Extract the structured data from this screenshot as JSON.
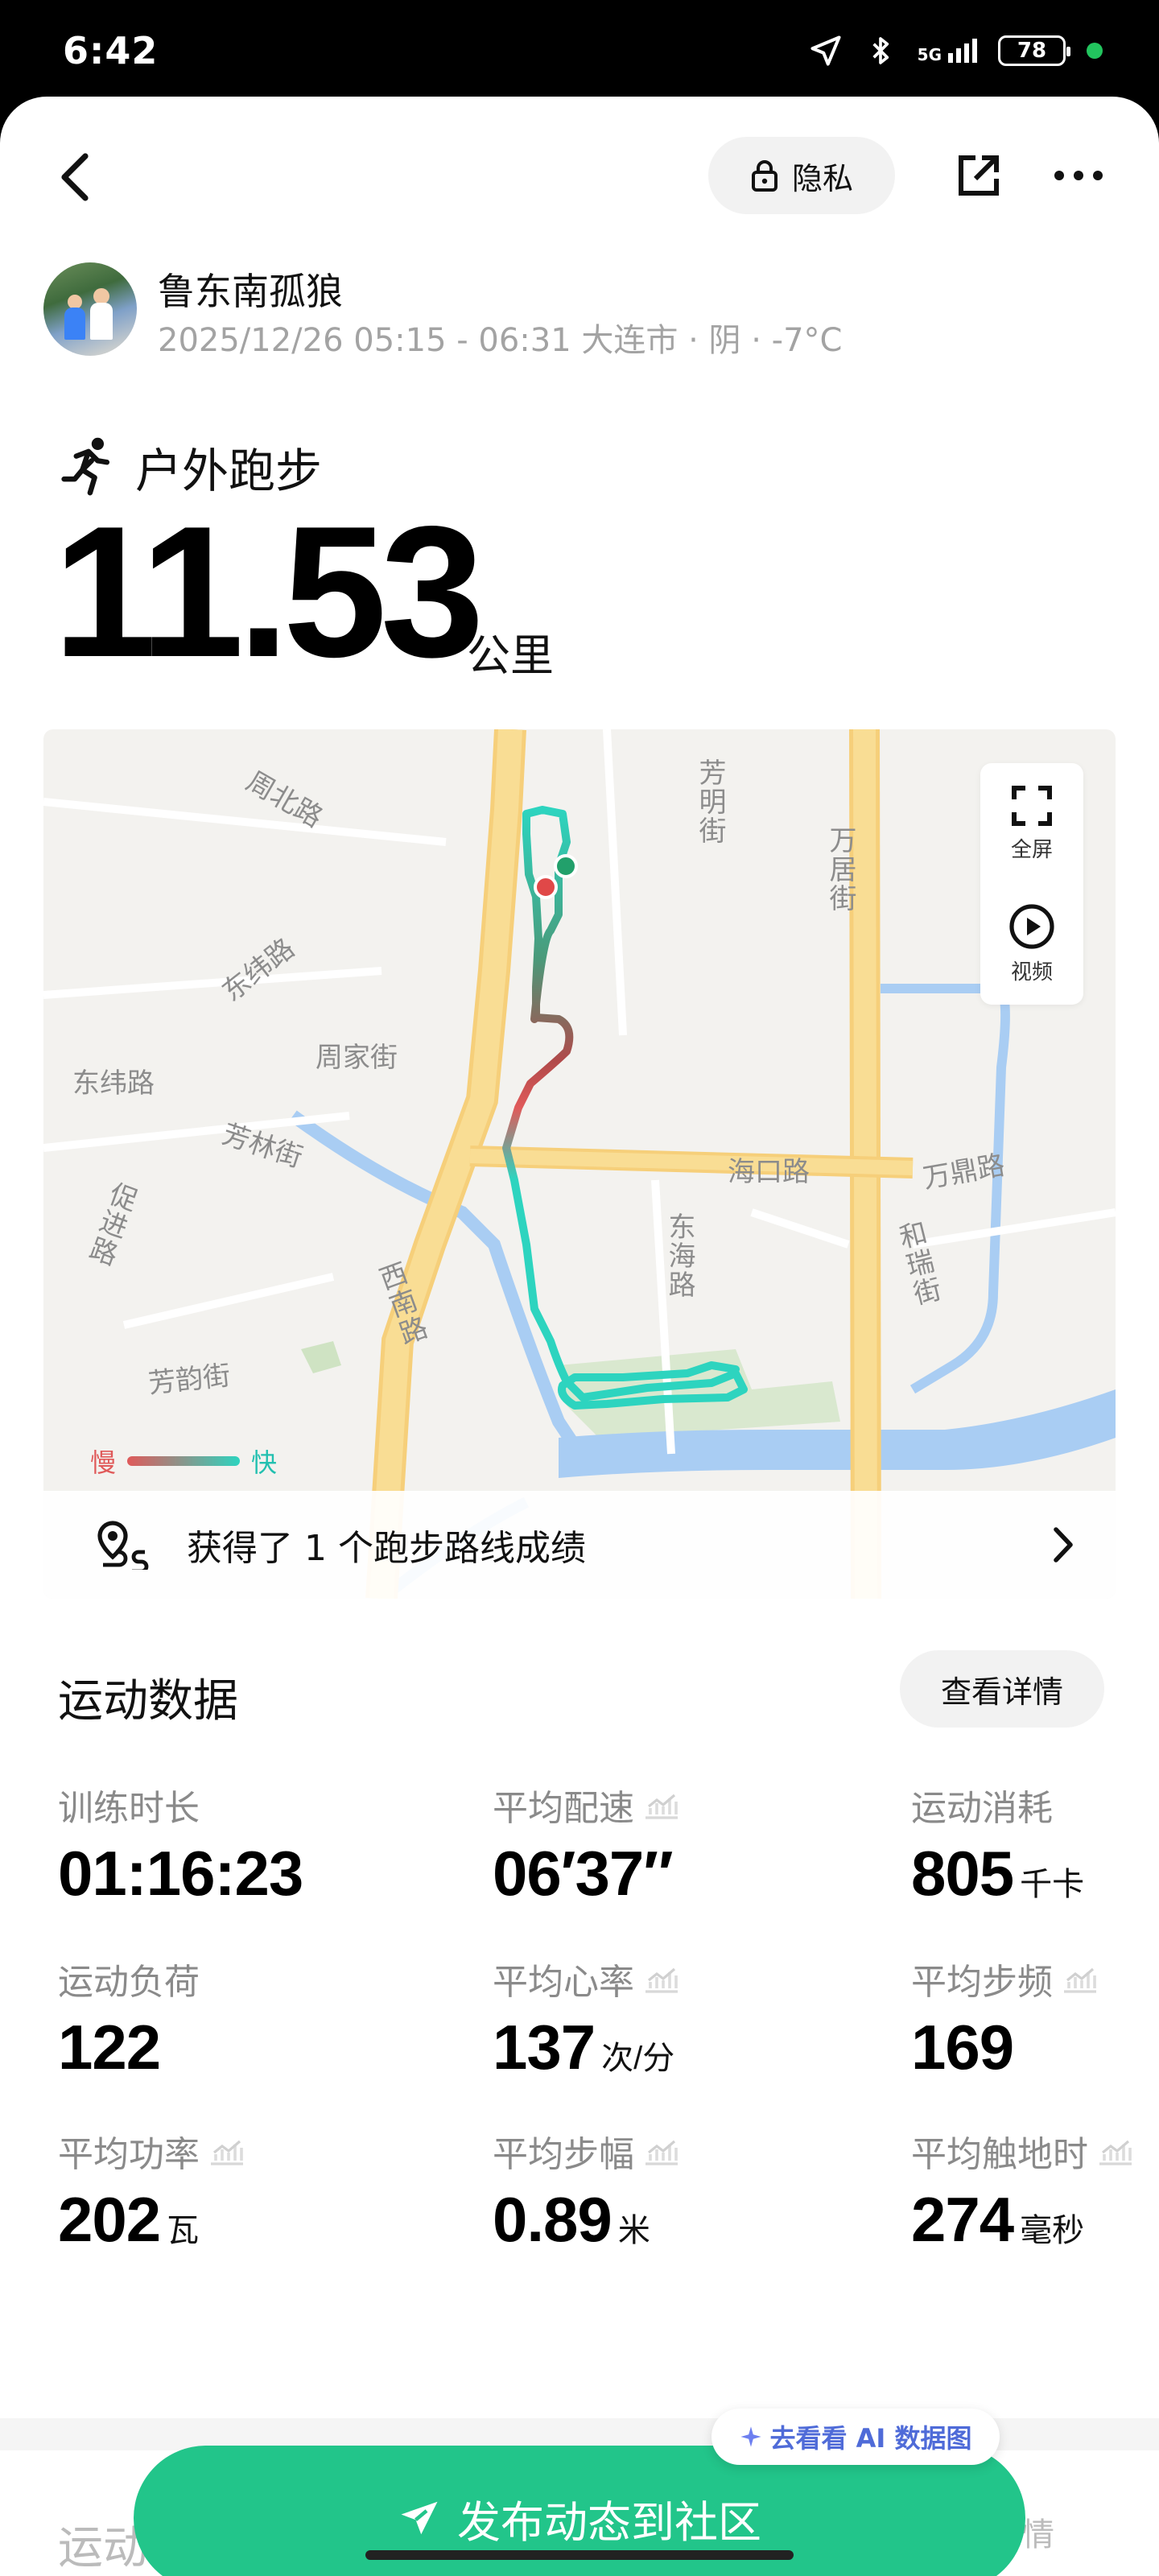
{
  "status_bar": {
    "time": "6:42",
    "network": "5G",
    "battery": "78"
  },
  "header": {
    "privacy_label": "隐私"
  },
  "user": {
    "name": "鲁东南孤狼",
    "meta": "2025/12/26 05:15 - 06:31 大连市 · 阴 · -7°C"
  },
  "activity": {
    "type": "户外跑步",
    "distance": "11.53",
    "distance_unit": "公里"
  },
  "map": {
    "labels": {
      "zhoubei": "周北路",
      "dongwei1": "东纬路",
      "dongwei2": "东纬路",
      "zhoujia": "周家街",
      "fanglin": "芳林街",
      "cujin": "促进路",
      "xinan": "西南路",
      "fangyun": "芳韵街",
      "fangming": "芳明街",
      "wanju": "万居街",
      "haikou": "海口路",
      "donghai": "东海路",
      "wanding": "万鼎路",
      "herui": "和瑞街"
    },
    "controls": {
      "fullscreen": "全屏",
      "video": "视频"
    },
    "legend": {
      "slow": "慢",
      "fast": "快"
    },
    "achievement": "获得了 1 个跑步路线成绩",
    "colors": {
      "slow": "#e05a5a",
      "fast": "#2dd4bf",
      "road": "#f9dd94",
      "water": "#a9cdf3"
    }
  },
  "sport_data": {
    "title": "运动数据",
    "detail_button": "查看详情",
    "metrics": [
      {
        "label": "训练时长",
        "value": "01:16:23",
        "unit": ""
      },
      {
        "label": "平均配速",
        "value": "06′37″",
        "unit": ""
      },
      {
        "label": "运动消耗",
        "value": "805",
        "unit": "千卡"
      },
      {
        "label": "运动负荷",
        "value": "122",
        "unit": ""
      },
      {
        "label": "平均心率",
        "value": "137",
        "unit": "次/分"
      },
      {
        "label": "平均步频",
        "value": "169",
        "unit": ""
      },
      {
        "label": "平均功率",
        "value": "202",
        "unit": "瓦"
      },
      {
        "label": "平均步幅",
        "value": "0.89",
        "unit": "米"
      },
      {
        "label": "平均触地时",
        "value": "274",
        "unit": "毫秒"
      }
    ]
  },
  "ai_chip": "去看看 AI 数据图",
  "publish_button": "发布动态到社区",
  "section2": {
    "title": "运动",
    "detail": "详情"
  },
  "brand_color": "#22c58a"
}
